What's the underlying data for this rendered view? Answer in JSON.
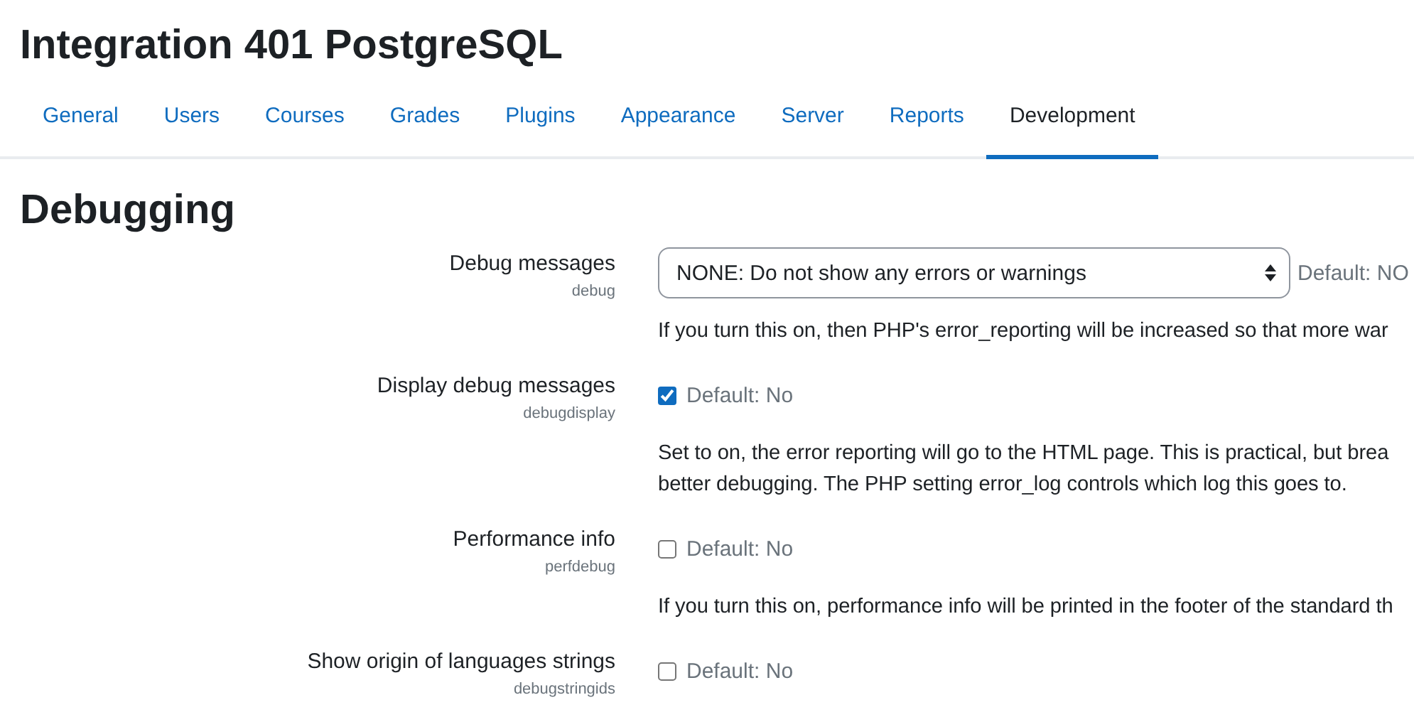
{
  "page_title": "Integration 401 PostgreSQL",
  "tabs": [
    {
      "label": "General",
      "selected": false
    },
    {
      "label": "Users",
      "selected": false
    },
    {
      "label": "Courses",
      "selected": false
    },
    {
      "label": "Grades",
      "selected": false
    },
    {
      "label": "Plugins",
      "selected": false
    },
    {
      "label": "Appearance",
      "selected": false
    },
    {
      "label": "Server",
      "selected": false
    },
    {
      "label": "Reports",
      "selected": false
    },
    {
      "label": "Development",
      "selected": true
    }
  ],
  "section_title": "Debugging",
  "settings": [
    {
      "kind": "select",
      "label": "Debug messages",
      "name": "debug",
      "value": "NONE: Do not show any errors or warnings",
      "default": "Default: NO",
      "description": [
        "If you turn this on, then PHP's error_reporting will be increased so that more war"
      ]
    },
    {
      "kind": "checkbox",
      "label": "Display debug messages",
      "name": "debugdisplay",
      "checked": true,
      "default": "Default: No",
      "description": [
        "Set to on, the error reporting will go to the HTML page. This is practical, but brea",
        "better debugging. The PHP setting error_log controls which log this goes to."
      ]
    },
    {
      "kind": "checkbox",
      "label": "Performance info",
      "name": "perfdebug",
      "checked": false,
      "default": "Default: No",
      "description": [
        "If you turn this on, performance info will be printed in the footer of the standard th"
      ]
    },
    {
      "kind": "checkbox",
      "label": "Show origin of languages strings",
      "name": "debugstringids",
      "checked": false,
      "default": "Default: No"
    }
  ]
}
